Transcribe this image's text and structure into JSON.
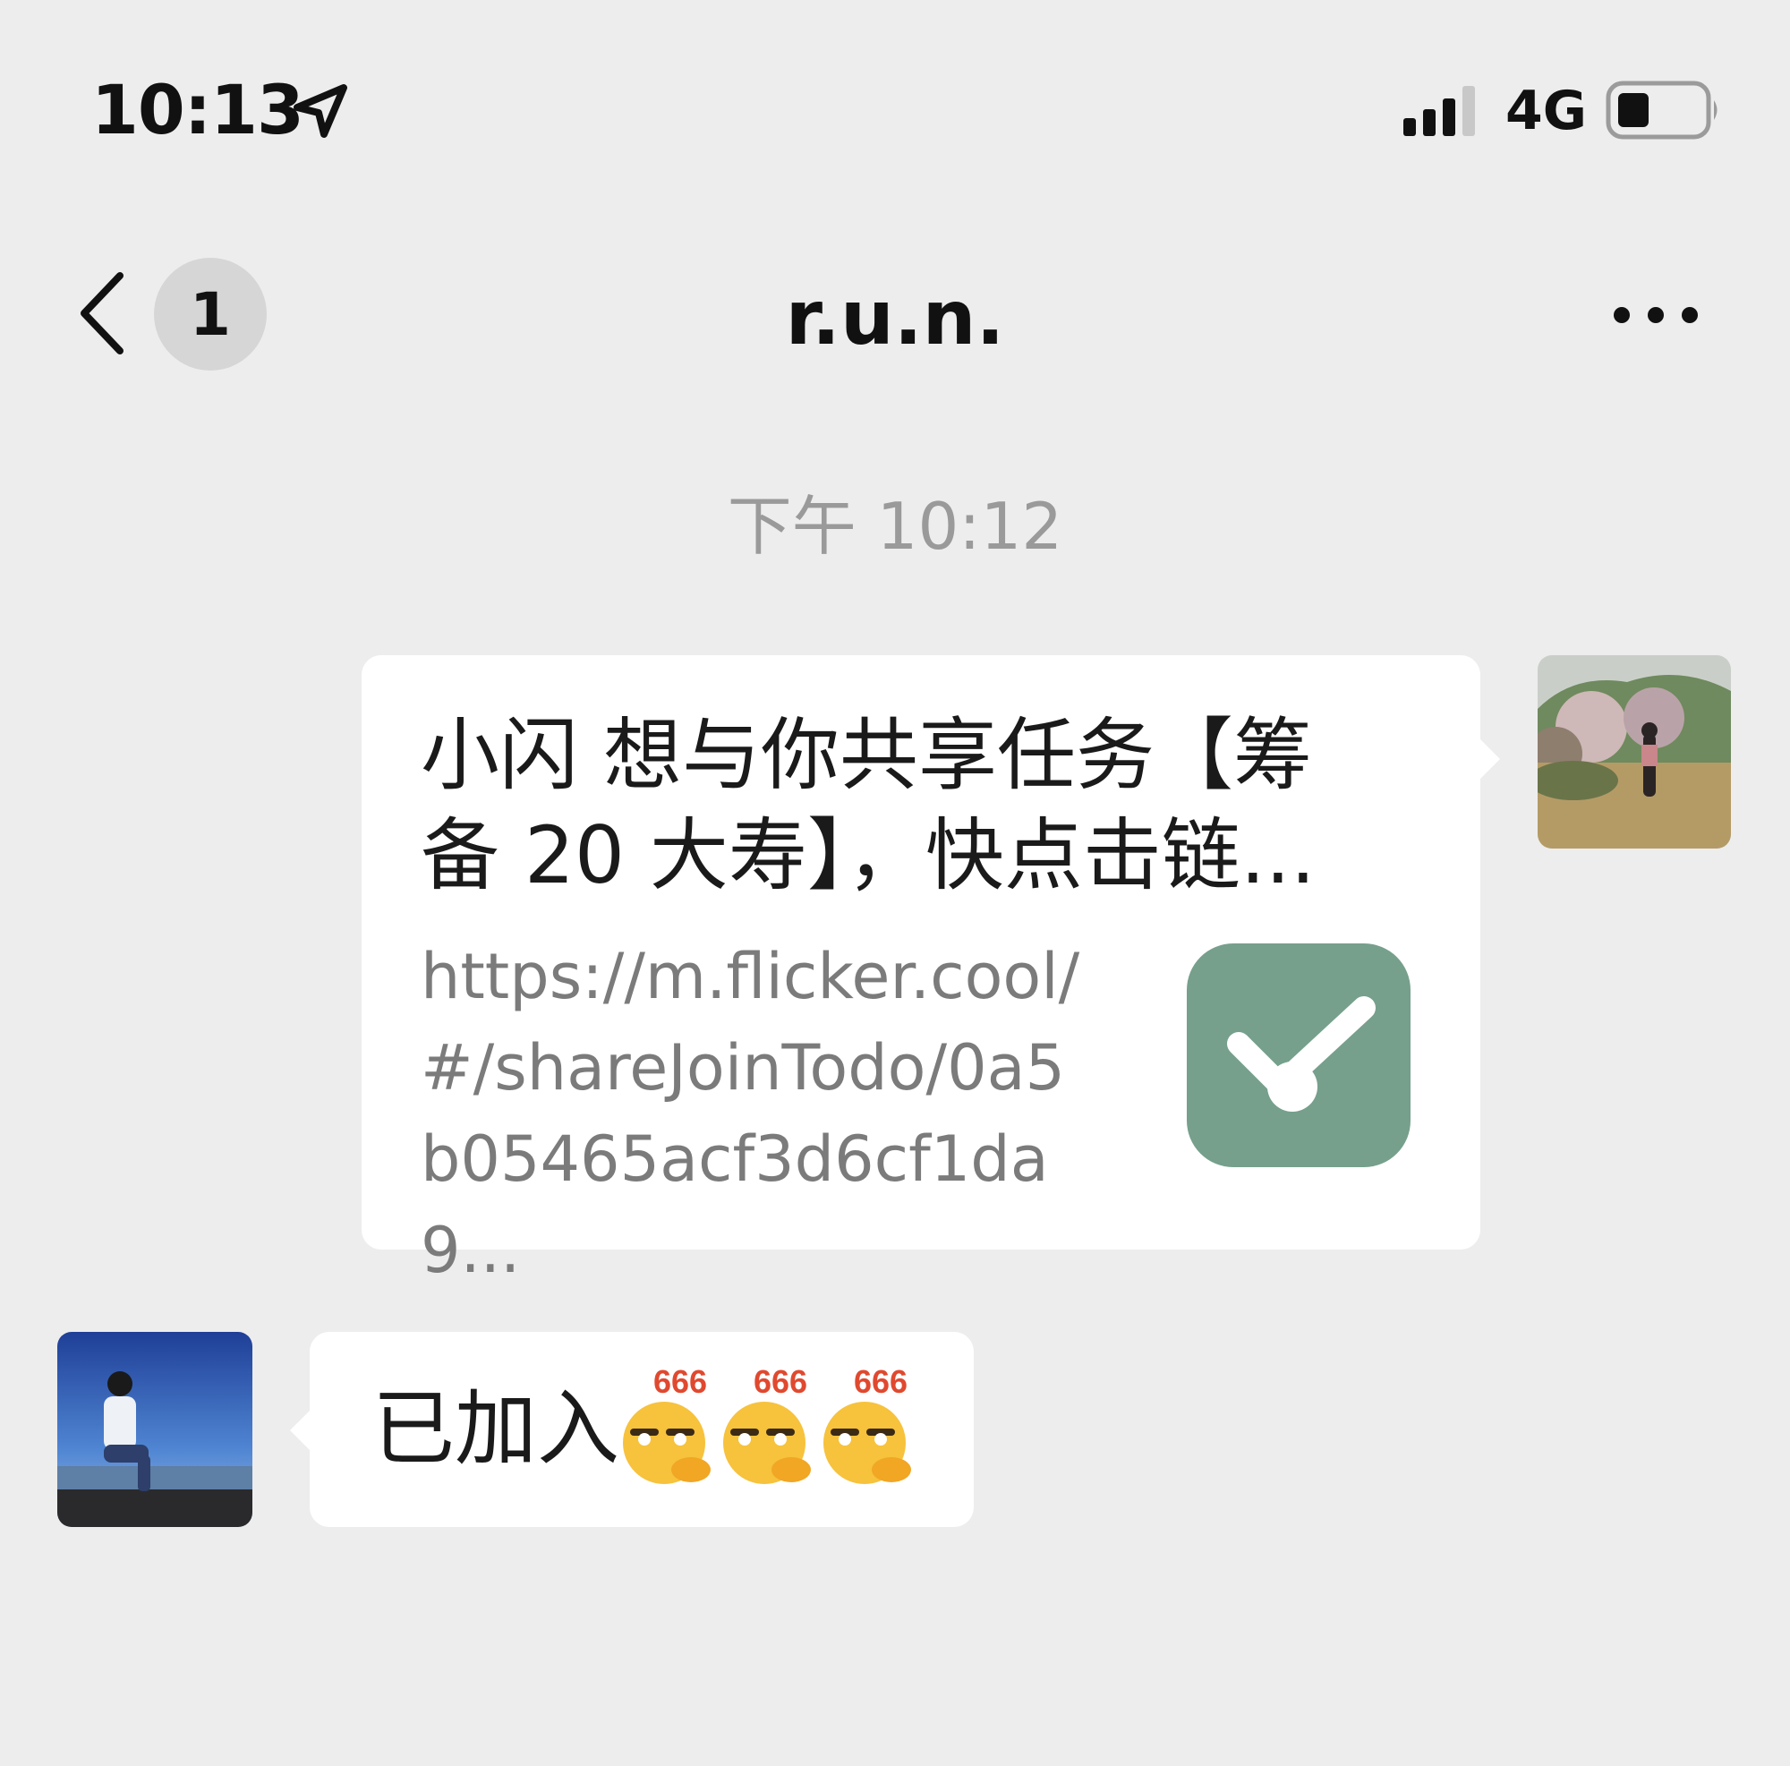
{
  "status_bar": {
    "time": "10:13",
    "network": "4G"
  },
  "nav": {
    "unread_count": "1",
    "title": "r.u.n."
  },
  "messages": {
    "timestamp": "下午 10:12",
    "shared_link": {
      "title": "小闪 想与你共享任务【筹备 20 大寿】，快点击链...",
      "url": "https://m.flicker.cool/#/shareJoinTodo/0a5b05465acf3d6cf1da9..."
    },
    "reply": {
      "text": "已加入",
      "emoji_label": "666",
      "emoji_count": 3
    }
  },
  "colors": {
    "background": "#ededed",
    "bubble": "#ffffff",
    "app_logo": "#76a08c",
    "timestamp_text": "#9a9a9a",
    "emoji_text": "#e0492f"
  }
}
